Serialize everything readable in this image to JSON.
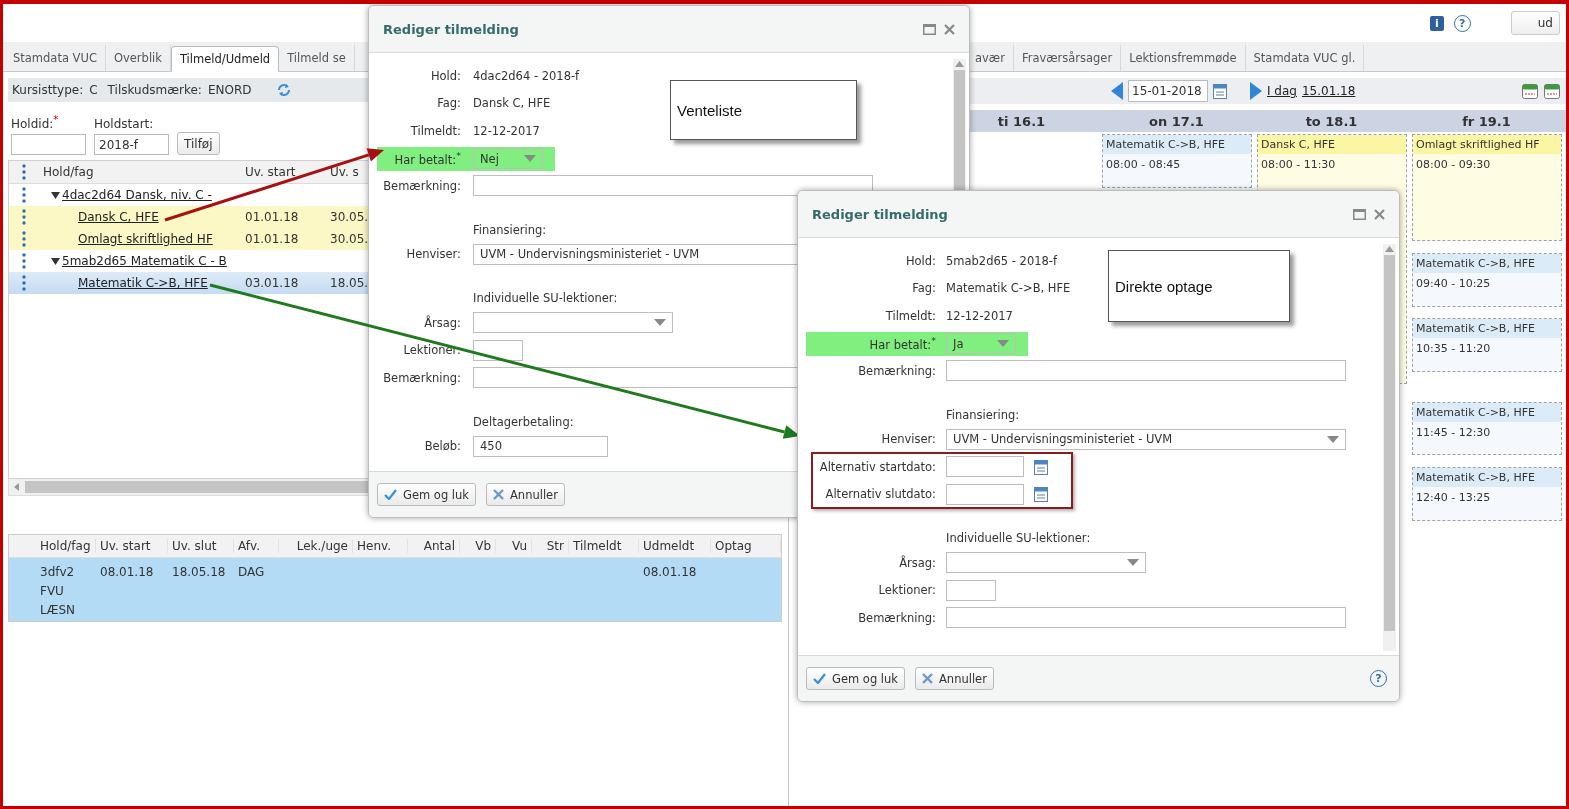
{
  "header": {
    "info_glyph": "i",
    "help_glyph": "?",
    "logout": "ud"
  },
  "tabs": [
    {
      "label": "Stamdata VUC",
      "selected": false
    },
    {
      "label": "Overblik",
      "selected": false
    },
    {
      "label": "Tilmeld/Udmeld",
      "selected": true
    },
    {
      "label": "Tilmeld se",
      "selected": false
    }
  ],
  "more_tabs": [
    {
      "label": "avær",
      "selected": false
    },
    {
      "label": "Fraværsårsager",
      "selected": false
    },
    {
      "label": "Lektionsfremmøde",
      "selected": false
    },
    {
      "label": "Stamdata VUC gl.",
      "selected": false
    }
  ],
  "student_info": [
    {
      "label": "Kursisttype:",
      "value": "C"
    },
    {
      "label": "Tilskudsmærke:",
      "value": "ENORD"
    }
  ],
  "add_form": {
    "fields": [
      {
        "label": "Holdid:$^{*}$"
      },
      {
        "label": "Holdstart:",
        "value": "2018-f"
      }
    ],
    "button": "Tilføj"
  },
  "tree": {
    "columns": [
      "Hold/fag",
      "Uv. start",
      "Uv. s"
    ],
    "groups": [
      {
        "label": "4dac2d64 Dansk, niv. C -",
        "expanded": true,
        "children": [
          {
            "cells": [
              "Dansk C, HFE",
              "01.01.18",
              "30.05."
            ],
            "highlighted": true,
            "selected": false
          },
          {
            "cells": [
              "Omlagt skriftlighed HF",
              "01.01.18",
              "30.05."
            ],
            "highlighted": true,
            "selected": false
          }
        ]
      },
      {
        "label": "5mab2d65 Matematik C - B",
        "expanded": true,
        "children": [
          {
            "cells": [
              "Matematik C->B, HFE",
              "03.01.18",
              "18.05."
            ],
            "highlighted": false,
            "selected": true
          }
        ]
      }
    ]
  },
  "enrollments": {
    "columns": [
      "Hold/fag",
      "Uv. start",
      "Uv. slut",
      "Afv.",
      "Lek./uge",
      "Henv.",
      "Antal",
      "Vb",
      "Vu",
      "Str",
      "Tilmeldt",
      "Udmeldt",
      "Optag"
    ],
    "rows": [
      {
        "hold_fag": "3dfv2 FVU LÆSN",
        "uv_start": "08.01.18",
        "uv_slut": "18.05.18",
        "afv": "DAG",
        "udmeldt": "08.01.18",
        "selected": true
      }
    ]
  },
  "calendar": {
    "date": "15-01-2018",
    "today_label": "I dag",
    "today_date": "15.01.18",
    "days": [
      {
        "label": "ti 16.1"
      },
      {
        "label": "on 17.1",
        "events": [
          {
            "title": "Matematik C->B, HFE",
            "time": "08:00 - 08:45",
            "color": "#dcebf8"
          }
        ]
      },
      {
        "label": "to 18.1",
        "events": [
          {
            "title": "Dansk C, HFE",
            "time": "08:00 - 11:30",
            "color": "#fbf6a3"
          }
        ]
      },
      {
        "label": "fr 19.1",
        "events": [
          {
            "title": "Omlagt skriftlighed HF",
            "time": "08:00 - 09:30",
            "color": "#fbf6a3"
          },
          {
            "title": "Matematik C->B, HFE",
            "time": "09:40 - 10:25",
            "color": "#dcebf8"
          },
          {
            "title": "Matematik C->B, HFE",
            "time": "10:35 - 11:20",
            "color": "#dcebf8"
          },
          {
            "title": "Matematik C->B, HFE",
            "time": "11:45 - 12:30",
            "color": "#dcebf8"
          },
          {
            "title": "Matematik C->B, HFE",
            "time": "12:40 - 13:25",
            "color": "#dcebf8"
          }
        ]
      }
    ]
  },
  "dialogs": [
    {
      "title": "Rediger tilmelding",
      "note": "Venteliste",
      "fields": [
        {
          "kind": "text",
          "label": "Hold:",
          "value": "4dac2d64 - 2018-f"
        },
        {
          "kind": "text",
          "label": "Fag:",
          "value": "Dansk C, HFE"
        },
        {
          "kind": "text",
          "label": "Tilmeldt:",
          "value": "12-12-2017"
        },
        {
          "kind": "toggle",
          "label": "Har betalt:$^{*}$",
          "value": "Nej",
          "highlighted": true
        },
        {
          "kind": "input",
          "label": "Bemærkning:"
        },
        {
          "kind": "section",
          "label": "Finansiering:"
        },
        {
          "kind": "select",
          "label": "Henviser:",
          "value": "UVM - Undervisningsministeriet - UVM"
        },
        {
          "kind": "section",
          "label": "Individuelle SU-lektioner:"
        },
        {
          "kind": "choice",
          "label": "Årsag:"
        },
        {
          "kind": "number",
          "label": "Lektioner:"
        },
        {
          "kind": "input",
          "label": "Bemærkning:"
        },
        {
          "kind": "section",
          "label": "Deltagerbetaling:"
        },
        {
          "kind": "amount",
          "label": "Beløb:",
          "value": "450"
        }
      ],
      "buttons": [
        {
          "label": "Gem og luk",
          "kind": "save"
        },
        {
          "label": "Annuller",
          "kind": "cancel"
        }
      ]
    },
    {
      "title": "Rediger tilmelding",
      "note": "Direkte optage",
      "help": "?",
      "fields": [
        {
          "kind": "text",
          "label": "Hold:",
          "value": "5mab2d65 - 2018-f"
        },
        {
          "kind": "text",
          "label": "Fag:",
          "value": "Matematik C->B, HFE"
        },
        {
          "kind": "text",
          "label": "Tilmeldt:",
          "value": "12-12-2017"
        },
        {
          "kind": "toggle",
          "label": "Har betalt:$^{*}$",
          "value": "Ja",
          "highlighted": true
        },
        {
          "kind": "input",
          "label": "Bemærkning:"
        },
        {
          "kind": "section",
          "label": "Finansiering:"
        },
        {
          "kind": "select",
          "label": "Henviser:",
          "value": "UVM - Undervisningsministeriet - UVM"
        },
        {
          "kind": "group",
          "outlined": true,
          "fields": [
            {
              "kind": "date",
              "label": "Alternativ startdato:"
            },
            {
              "kind": "date",
              "label": "Alternativ slutdato:"
            }
          ]
        },
        {
          "kind": "section",
          "label": "Individuelle SU-lektioner:"
        },
        {
          "kind": "choice",
          "label": "Årsag:"
        },
        {
          "kind": "number",
          "label": "Lektioner:"
        },
        {
          "kind": "input",
          "label": "Bemærkning:"
        }
      ],
      "buttons": [
        {
          "label": "Gem og luk",
          "kind": "save"
        },
        {
          "label": "Annuller",
          "kind": "cancel"
        }
      ]
    }
  ]
}
